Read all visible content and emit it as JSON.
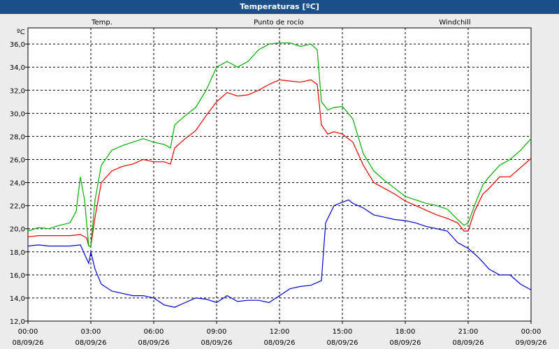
{
  "window": {
    "title": "Temperaturas [ºC]"
  },
  "chart_data": {
    "type": "line",
    "unit_label": "ºC",
    "ylim": [
      12,
      37.4
    ],
    "yticks": [
      12,
      14,
      16,
      18,
      20,
      22,
      24,
      26,
      28,
      30,
      32,
      34,
      36
    ],
    "ytick_labels": [
      "12,0",
      "14,0",
      "16,0",
      "18,0",
      "20,0",
      "22,0",
      "24,0",
      "26,0",
      "28,0",
      "30,0",
      "32,0",
      "34,0",
      "36,0"
    ],
    "xlim": [
      0,
      24
    ],
    "xticks": [
      {
        "hour": 0,
        "time": "00:00",
        "date": "08/09/26"
      },
      {
        "hour": 3,
        "time": "03:00",
        "date": "08/09/26"
      },
      {
        "hour": 6,
        "time": "06:00",
        "date": "08/09/26"
      },
      {
        "hour": 9,
        "time": "09:00",
        "date": "08/09/26"
      },
      {
        "hour": 12,
        "time": "12:00",
        "date": "08/09/26"
      },
      {
        "hour": 15,
        "time": "15:00",
        "date": "08/09/26"
      },
      {
        "hour": 18,
        "time": "18:00",
        "date": "08/09/26"
      },
      {
        "hour": 21,
        "time": "21:00",
        "date": "08/09/26"
      },
      {
        "hour": 24,
        "time": "00:00",
        "date": "09/09/26"
      }
    ],
    "grid": true,
    "series": [
      {
        "name": "Temp.",
        "color": "#dd0000",
        "points": [
          [
            0,
            19.3
          ],
          [
            0.5,
            19.4
          ],
          [
            1,
            19.4
          ],
          [
            1.5,
            19.4
          ],
          [
            2,
            19.4
          ],
          [
            2.5,
            19.5
          ],
          [
            2.8,
            19.2
          ],
          [
            2.9,
            18.5
          ],
          [
            3,
            18.5
          ],
          [
            3.2,
            21.0
          ],
          [
            3.5,
            24.0
          ],
          [
            4,
            25.0
          ],
          [
            4.5,
            25.4
          ],
          [
            5,
            25.6
          ],
          [
            5.5,
            26.0
          ],
          [
            6,
            25.8
          ],
          [
            6.3,
            25.8
          ],
          [
            6.5,
            25.8
          ],
          [
            6.8,
            25.6
          ],
          [
            7,
            27.0
          ],
          [
            7.5,
            27.8
          ],
          [
            8,
            28.5
          ],
          [
            8.5,
            29.8
          ],
          [
            9,
            31.0
          ],
          [
            9.5,
            31.8
          ],
          [
            10,
            31.5
          ],
          [
            10.5,
            31.6
          ],
          [
            11,
            32.0
          ],
          [
            11.5,
            32.5
          ],
          [
            12,
            32.9
          ],
          [
            12.5,
            32.8
          ],
          [
            13,
            32.7
          ],
          [
            13.5,
            32.9
          ],
          [
            13.8,
            32.5
          ],
          [
            14,
            29.0
          ],
          [
            14.3,
            28.2
          ],
          [
            14.6,
            28.4
          ],
          [
            15,
            28.2
          ],
          [
            15.5,
            27.5
          ],
          [
            16,
            25.5
          ],
          [
            16.5,
            24.0
          ],
          [
            17,
            23.5
          ],
          [
            17.5,
            23.0
          ],
          [
            18,
            22.4
          ],
          [
            18.5,
            22.0
          ],
          [
            19,
            21.6
          ],
          [
            19.5,
            21.2
          ],
          [
            20,
            20.9
          ],
          [
            20.5,
            20.5
          ],
          [
            20.8,
            19.8
          ],
          [
            21,
            19.8
          ],
          [
            21.3,
            21.5
          ],
          [
            21.7,
            23.0
          ],
          [
            22,
            23.5
          ],
          [
            22.5,
            24.5
          ],
          [
            23,
            24.5
          ],
          [
            23.5,
            25.3
          ],
          [
            24,
            26.1
          ]
        ]
      },
      {
        "name": "Punto de rocío",
        "color": "#0000cc",
        "points": [
          [
            0,
            18.5
          ],
          [
            0.5,
            18.6
          ],
          [
            1,
            18.5
          ],
          [
            1.5,
            18.5
          ],
          [
            2,
            18.5
          ],
          [
            2.5,
            18.6
          ],
          [
            2.8,
            17.4
          ],
          [
            2.9,
            17.0
          ],
          [
            3,
            18.0
          ],
          [
            3.2,
            16.5
          ],
          [
            3.5,
            15.2
          ],
          [
            4,
            14.6
          ],
          [
            4.5,
            14.4
          ],
          [
            5,
            14.2
          ],
          [
            5.5,
            14.2
          ],
          [
            6,
            14.0
          ],
          [
            6.5,
            13.4
          ],
          [
            7,
            13.2
          ],
          [
            7.5,
            13.6
          ],
          [
            8,
            14.0
          ],
          [
            8.5,
            13.9
          ],
          [
            9,
            13.6
          ],
          [
            9.5,
            14.2
          ],
          [
            10,
            13.7
          ],
          [
            10.5,
            13.8
          ],
          [
            11,
            13.8
          ],
          [
            11.5,
            13.6
          ],
          [
            12,
            14.2
          ],
          [
            12.5,
            14.8
          ],
          [
            13,
            15.0
          ],
          [
            13.5,
            15.1
          ],
          [
            14,
            15.5
          ],
          [
            14.2,
            20.5
          ],
          [
            14.6,
            22.0
          ],
          [
            15,
            22.3
          ],
          [
            15.3,
            22.5
          ],
          [
            15.5,
            22.2
          ],
          [
            16,
            21.8
          ],
          [
            16.5,
            21.2
          ],
          [
            17,
            21.0
          ],
          [
            17.5,
            20.8
          ],
          [
            18,
            20.7
          ],
          [
            18.5,
            20.5
          ],
          [
            19,
            20.2
          ],
          [
            19.5,
            20.0
          ],
          [
            20,
            19.8
          ],
          [
            20.5,
            18.8
          ],
          [
            21,
            18.3
          ],
          [
            21.5,
            17.5
          ],
          [
            22,
            16.5
          ],
          [
            22.5,
            16.0
          ],
          [
            23,
            16.0
          ],
          [
            23.5,
            15.2
          ],
          [
            24,
            14.7
          ]
        ]
      },
      {
        "name": "Windchill",
        "color": "#00aa00",
        "points": [
          [
            0,
            19.8
          ],
          [
            0.5,
            20.1
          ],
          [
            1,
            20.0
          ],
          [
            1.5,
            20.3
          ],
          [
            2,
            20.5
          ],
          [
            2.3,
            21.5
          ],
          [
            2.5,
            24.5
          ],
          [
            2.7,
            22.5
          ],
          [
            2.9,
            18.5
          ],
          [
            3,
            18.5
          ],
          [
            3.2,
            22.5
          ],
          [
            3.5,
            25.5
          ],
          [
            4,
            26.8
          ],
          [
            4.5,
            27.2
          ],
          [
            5,
            27.5
          ],
          [
            5.5,
            27.8
          ],
          [
            6,
            27.5
          ],
          [
            6.5,
            27.3
          ],
          [
            6.8,
            27.0
          ],
          [
            7,
            29.0
          ],
          [
            7.5,
            29.8
          ],
          [
            8,
            30.5
          ],
          [
            8.5,
            32.0
          ],
          [
            9,
            34.0
          ],
          [
            9.5,
            34.5
          ],
          [
            10,
            34.0
          ],
          [
            10.5,
            34.5
          ],
          [
            11,
            35.5
          ],
          [
            11.5,
            36.0
          ],
          [
            12,
            36.1
          ],
          [
            12.5,
            36.1
          ],
          [
            13,
            35.8
          ],
          [
            13.5,
            36.0
          ],
          [
            13.8,
            35.5
          ],
          [
            14,
            31.0
          ],
          [
            14.3,
            30.3
          ],
          [
            14.6,
            30.5
          ],
          [
            15,
            30.6
          ],
          [
            15.5,
            29.5
          ],
          [
            16,
            26.5
          ],
          [
            16.5,
            25.0
          ],
          [
            17,
            24.2
          ],
          [
            17.5,
            23.5
          ],
          [
            18,
            22.8
          ],
          [
            18.5,
            22.5
          ],
          [
            19,
            22.2
          ],
          [
            19.5,
            22.0
          ],
          [
            20,
            21.7
          ],
          [
            20.5,
            20.8
          ],
          [
            20.8,
            20.3
          ],
          [
            21,
            20.5
          ],
          [
            21.3,
            22.0
          ],
          [
            21.7,
            23.8
          ],
          [
            22,
            24.5
          ],
          [
            22.5,
            25.5
          ],
          [
            23,
            26.0
          ],
          [
            23.5,
            26.8
          ],
          [
            24,
            27.8
          ]
        ]
      }
    ]
  }
}
